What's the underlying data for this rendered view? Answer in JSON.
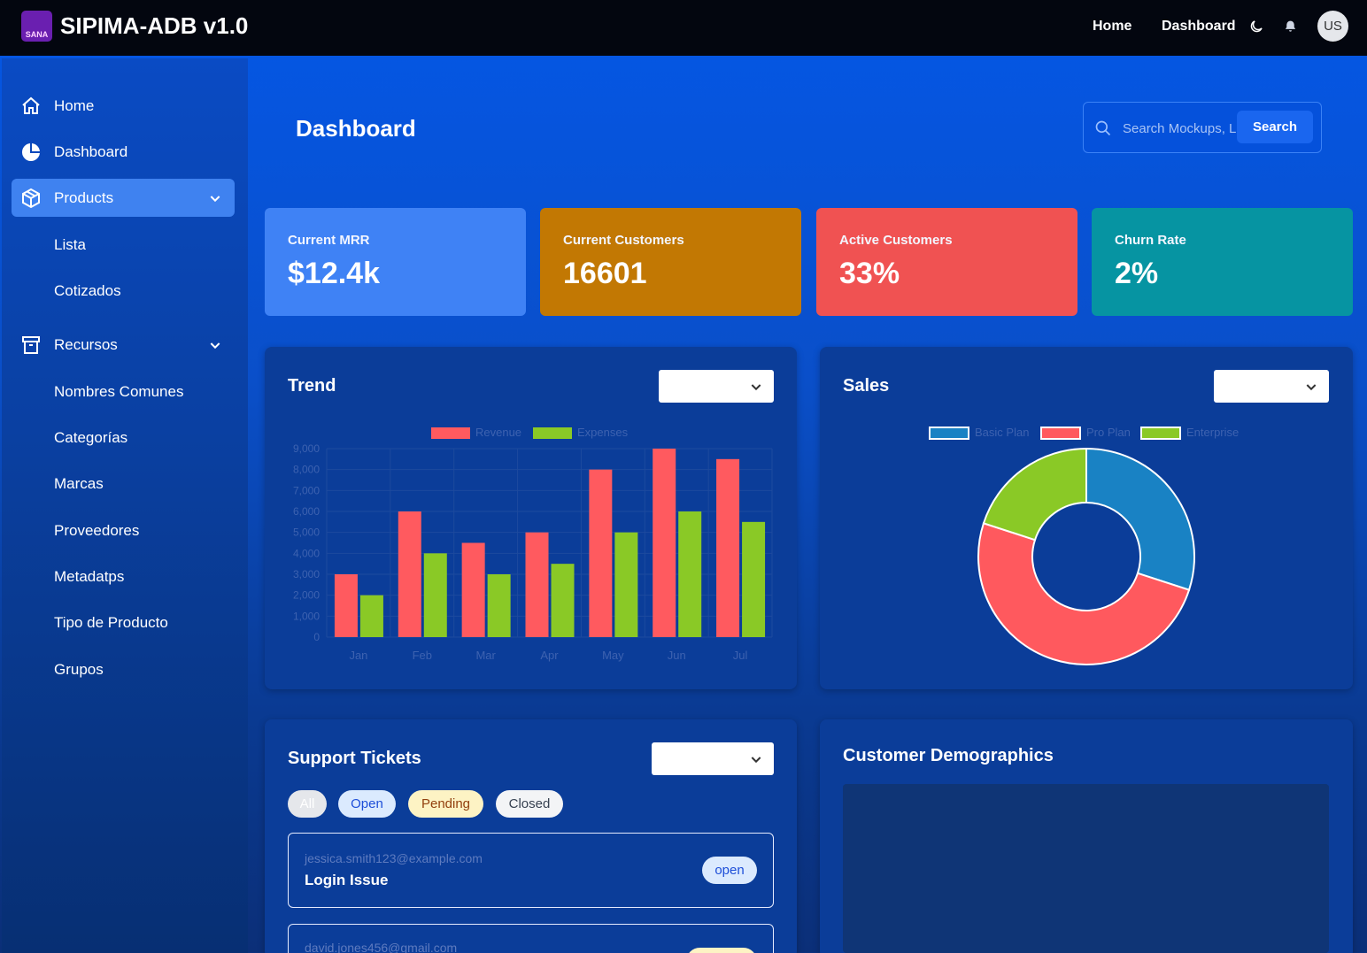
{
  "app": {
    "logo_text": "SANA",
    "title": "SIPIMA-ADB v1.0"
  },
  "topnav": {
    "home": "Home",
    "dashboard": "Dashboard",
    "avatar": "US"
  },
  "sidebar": {
    "items": [
      {
        "label": "Home",
        "icon": "home-icon"
      },
      {
        "label": "Dashboard",
        "icon": "pie-chart-icon"
      },
      {
        "label": "Products",
        "icon": "box-icon",
        "active": true,
        "sub": [
          "Lista",
          "Cotizados"
        ]
      },
      {
        "label": "Recursos",
        "icon": "archive-icon",
        "sub": [
          "Nombres Comunes",
          "Categorías",
          "Marcas",
          "Proveedores",
          "Metadatps",
          "Tipo de Producto",
          "Grupos"
        ]
      }
    ]
  },
  "main": {
    "title": "Dashboard",
    "search": {
      "placeholder": "Search Mockups, Logos...",
      "button": "Search"
    }
  },
  "stats": [
    {
      "label": "Current MRR",
      "value": "$12.4k",
      "color": "#3f82f5"
    },
    {
      "label": "Current Customers",
      "value": "16601",
      "color": "#c27803"
    },
    {
      "label": "Active Customers",
      "value": "33%",
      "color": "#f05252"
    },
    {
      "label": "Churn Rate",
      "value": "2%",
      "color": "#0694a2"
    }
  ],
  "trend": {
    "title": "Trend"
  },
  "sales": {
    "title": "Sales"
  },
  "support": {
    "title": "Support Tickets",
    "filters": [
      "All",
      "Open",
      "Pending",
      "Closed"
    ],
    "tickets": [
      {
        "email": "jessica.smith123@example.com",
        "subject": "Login Issue",
        "status": "open"
      },
      {
        "email": "david.jones456@gmail.com",
        "subject": "",
        "status": ""
      }
    ]
  },
  "demographics": {
    "title": "Customer Demographics"
  },
  "chart_data": [
    {
      "type": "bar",
      "categories": [
        "Jan",
        "Feb",
        "Mar",
        "Apr",
        "May",
        "Jun",
        "Jul"
      ],
      "series": [
        {
          "name": "Revenue",
          "values": [
            3000,
            6000,
            4500,
            5000,
            8000,
            9000,
            8500
          ],
          "color": "#ff5a5f"
        },
        {
          "name": "Expenses",
          "values": [
            2000,
            4000,
            3000,
            3500,
            5000,
            6000,
            5500
          ],
          "color": "#8ac926"
        }
      ],
      "ylim": [
        0,
        9000
      ],
      "yticks": [
        "0",
        "1,000",
        "2,000",
        "3,000",
        "4,000",
        "5,000",
        "6,000",
        "7,000",
        "8,000",
        "9,000"
      ],
      "legend": "top",
      "grid": true
    },
    {
      "type": "pie",
      "donut": true,
      "labels": [
        "Basic Plan",
        "Pro Plan",
        "Enterprise"
      ],
      "values": [
        30,
        50,
        20
      ],
      "colors": [
        "#1982c4",
        "#ff595e",
        "#8ac926"
      ],
      "legend": "top"
    }
  ]
}
